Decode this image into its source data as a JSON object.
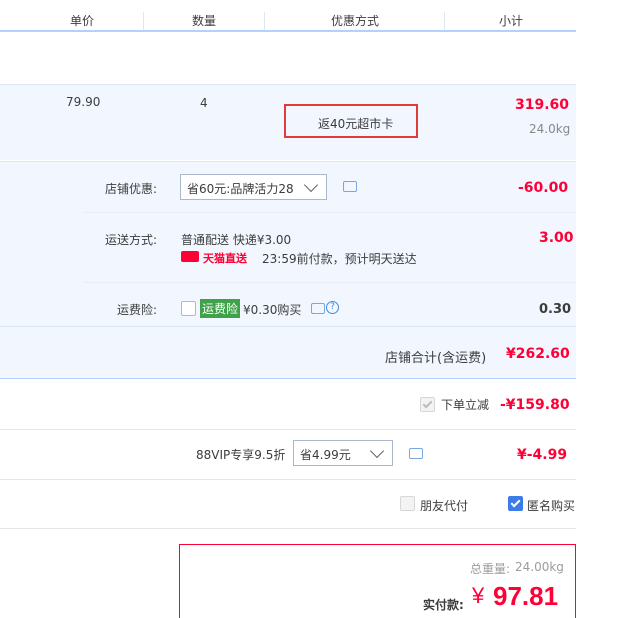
{
  "header": {
    "unit_price": "单价",
    "quantity": "数量",
    "discount_method": "优惠方式",
    "subtotal": "小计"
  },
  "item": {
    "price": "79.90",
    "quantity": "4",
    "promo": "返40元超市卡",
    "subtotal": "319.60",
    "weight": "24.0kg"
  },
  "shop_discount": {
    "label": "店铺优惠:",
    "selected": "省60元:品牌活力28",
    "value": "-60.00"
  },
  "shipping": {
    "label": "运送方式:",
    "method": "普通配送 快递¥3.00",
    "badge": "天猫直送",
    "note": "23:59前付款，预计明天送达",
    "value": "3.00"
  },
  "insurance": {
    "label": "运费险:",
    "tag": "运费险",
    "price_text": "¥0.30购买",
    "value": "0.30"
  },
  "shop_total": {
    "label": "店铺合计(含运费)",
    "value": "¥262.60"
  },
  "instant_discount": {
    "label": "下单立减",
    "value": "-¥159.80"
  },
  "vip": {
    "label": "88VIP专享9.5折",
    "selected": "省4.99元",
    "value": "¥-4.99"
  },
  "options": {
    "friend_pay": "朋友代付",
    "anonymous": "匿名购买"
  },
  "summary": {
    "weight_label": "总重量:",
    "weight_value": "24.00kg",
    "paid_label": "实付款:",
    "currency": "¥",
    "paid_value": "97.81"
  },
  "colors": {
    "accent_red": "#ff0036",
    "header_line": "#b2d1ff",
    "band_bg": "#f2f7ff",
    "tag_green": "#3fa149"
  }
}
